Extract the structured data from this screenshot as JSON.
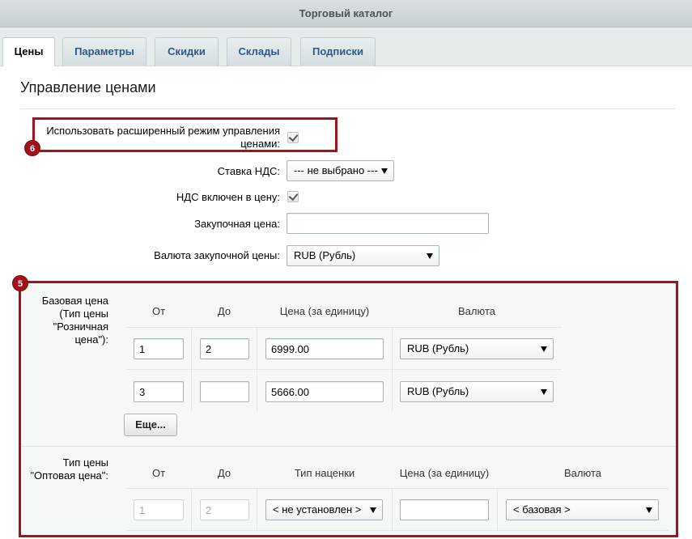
{
  "window": {
    "title": "Торговый каталог"
  },
  "tabs": [
    {
      "label": "Цены"
    },
    {
      "label": "Параметры"
    },
    {
      "label": "Скидки"
    },
    {
      "label": "Склады"
    },
    {
      "label": "Подписки"
    }
  ],
  "section": {
    "title": "Управление ценами"
  },
  "settings": {
    "extended_mode_label_line1": "Использовать расширенный режим управления",
    "extended_mode_label_line2": "ценами:",
    "vat_rate_label": "Ставка НДС:",
    "vat_rate_value": "--- не выбрано ---",
    "vat_included_label": "НДС включен в цену:",
    "purchase_price_label": "Закупочная цена:",
    "purchase_price_value": "",
    "purchase_currency_label": "Валюта закупочной цены:",
    "purchase_currency_value": "RUB (Рубль)"
  },
  "badges": {
    "extended_mode": "6",
    "price_block": "5"
  },
  "base_price": {
    "label_line1": "Базовая цена",
    "label_line2": "(Тип цены",
    "label_line3": "\"Розничная",
    "label_line4": "цена\"):",
    "headers": {
      "from": "От",
      "to": "До",
      "price": "Цена (за единицу)",
      "currency": "Валюта"
    },
    "rows": [
      {
        "from": "1",
        "to": "2",
        "price": "6999.00",
        "currency": "RUB (Рубль)"
      },
      {
        "from": "3",
        "to": "",
        "price": "5666.00",
        "currency": "RUB (Рубль)"
      }
    ],
    "more_button": "Еще..."
  },
  "wholesale_price": {
    "label_line1": "Тип цены",
    "label_line2": "\"Оптовая цена\":",
    "headers": {
      "from": "От",
      "to": "До",
      "markup_type": "Тип наценки",
      "price": "Цена (за единицу)",
      "currency": "Валюта"
    },
    "rows": [
      {
        "from": "1",
        "to": "2",
        "markup_type": "< не установлен >",
        "price": "",
        "currency": "< базовая >"
      }
    ]
  },
  "colors": {
    "accent_red": "#a1121c",
    "tab_link": "#2b5a8a"
  }
}
